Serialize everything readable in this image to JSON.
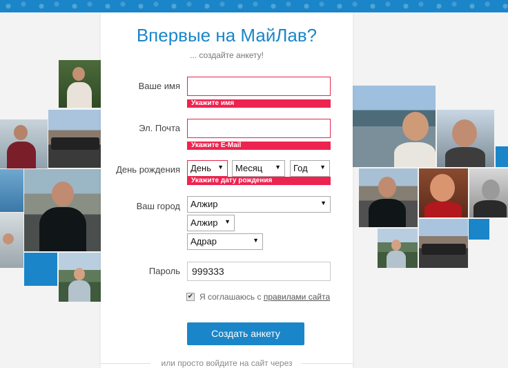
{
  "header": {
    "title": "Впервые на МайЛав?",
    "subtitle": "... создайте анкету!"
  },
  "form": {
    "name": {
      "label": "Ваше имя",
      "value": "",
      "error": "Укажите имя"
    },
    "email": {
      "label": "Эл. Почта",
      "value": "",
      "error": "Укажите E-Mail"
    },
    "birthday": {
      "label": "День рождения",
      "day": "День",
      "month": "Месяц",
      "year": "Год",
      "error": "Укажите дату рождения"
    },
    "city": {
      "label": "Ваш город",
      "country": "Алжир",
      "region": "Алжир",
      "city": "Адрар"
    },
    "password": {
      "label": "Пароль",
      "value": "999333"
    },
    "agree": {
      "checked": true,
      "check_glyph": "✔",
      "text": "Я соглашаюсь с",
      "link": "правилами сайта"
    },
    "submit_label": "Создать анкету"
  },
  "footer": {
    "alt_login_text": "или просто войдите на сайт через"
  },
  "colors": {
    "accent": "#1a86c9",
    "error": "#ed2350"
  }
}
